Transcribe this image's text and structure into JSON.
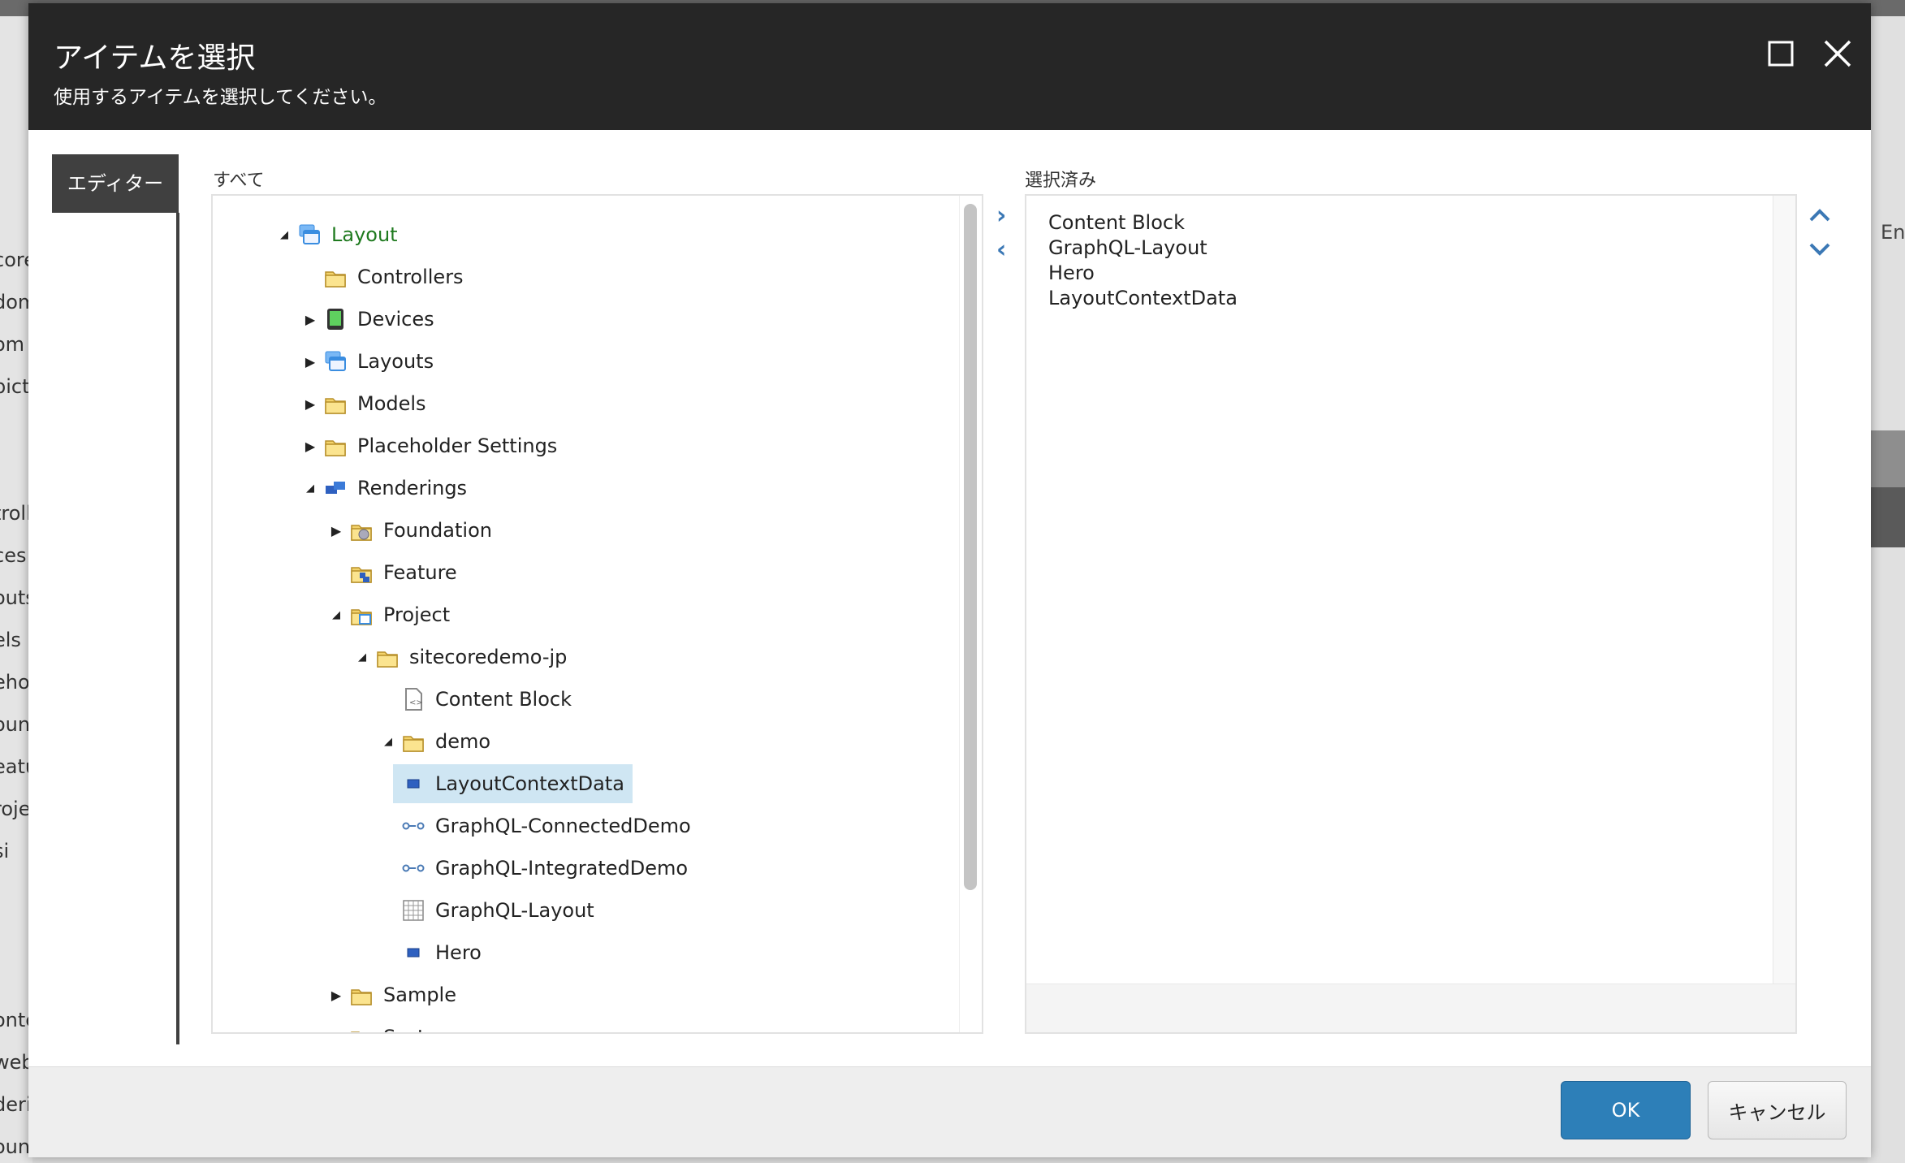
{
  "background": {
    "left_fragments": [
      "core",
      "dom",
      "om",
      "picti",
      "troll",
      "ces",
      "outs",
      "els",
      "eho",
      "oun",
      "eatu",
      "roje",
      "si",
      "onte",
      "webe",
      "deri",
      "oundation"
    ],
    "right_label": "Eng"
  },
  "dialog": {
    "title": "アイテムを選択",
    "subtitle": "使用するアイテムを選択してください。",
    "maximize_icon": "maximize-icon",
    "close_icon": "close-icon",
    "tab_label": "エディター",
    "all_label": "すべて",
    "selected_label": "選択済み",
    "tree": [
      {
        "label": "Layout",
        "level": 0,
        "toggle": "expanded",
        "icon": "layout-icon",
        "root": true
      },
      {
        "label": "Controllers",
        "level": 1,
        "toggle": "none",
        "icon": "folder-icon"
      },
      {
        "label": "Devices",
        "level": 1,
        "toggle": "collapsed",
        "icon": "device-icon"
      },
      {
        "label": "Layouts",
        "level": 1,
        "toggle": "collapsed",
        "icon": "layout-icon"
      },
      {
        "label": "Models",
        "level": 1,
        "toggle": "collapsed",
        "icon": "folder-icon"
      },
      {
        "label": "Placeholder Settings",
        "level": 1,
        "toggle": "collapsed",
        "icon": "folder-icon"
      },
      {
        "label": "Renderings",
        "level": 1,
        "toggle": "expanded",
        "icon": "renderings-icon"
      },
      {
        "label": "Foundation",
        "level": 2,
        "toggle": "collapsed",
        "icon": "folder-gear-icon"
      },
      {
        "label": "Feature",
        "level": 2,
        "toggle": "none",
        "icon": "folder-blocks-icon"
      },
      {
        "label": "Project",
        "level": 2,
        "toggle": "expanded",
        "icon": "folder-window-icon"
      },
      {
        "label": "sitecoredemo-jp",
        "level": 3,
        "toggle": "expanded",
        "icon": "folder-icon"
      },
      {
        "label": "Content Block",
        "level": 4,
        "toggle": "none",
        "icon": "code-file-icon"
      },
      {
        "label": "demo",
        "level": 4,
        "toggle": "expanded",
        "icon": "folder-icon"
      },
      {
        "label": "LayoutContextData",
        "level": 5,
        "toggle": "none",
        "icon": "rendering-icon",
        "selected": true
      },
      {
        "label": "GraphQL-ConnectedDemo",
        "level": 4,
        "toggle": "none",
        "icon": "connector-icon"
      },
      {
        "label": "GraphQL-IntegratedDemo",
        "level": 4,
        "toggle": "none",
        "icon": "connector-icon"
      },
      {
        "label": "GraphQL-Layout",
        "level": 4,
        "toggle": "none",
        "icon": "grid-icon"
      },
      {
        "label": "Hero",
        "level": 4,
        "toggle": "none",
        "icon": "rendering-icon"
      },
      {
        "label": "Sample",
        "level": 2,
        "toggle": "collapsed",
        "icon": "folder-icon"
      },
      {
        "label": "System",
        "level": 2,
        "toggle": "collapsed",
        "icon": "folder-icon"
      }
    ],
    "selected_items": [
      "Content Block",
      "GraphQL-Layout",
      "Hero",
      "LayoutContextData"
    ],
    "ok_label": "OK",
    "cancel_label": "キャンセル",
    "colors": {
      "header": "#262626",
      "ok": "#2d7fb8",
      "selection": "#cfe6f3",
      "root_text": "#1f7a1f",
      "arrows": "#3b78b5"
    }
  }
}
